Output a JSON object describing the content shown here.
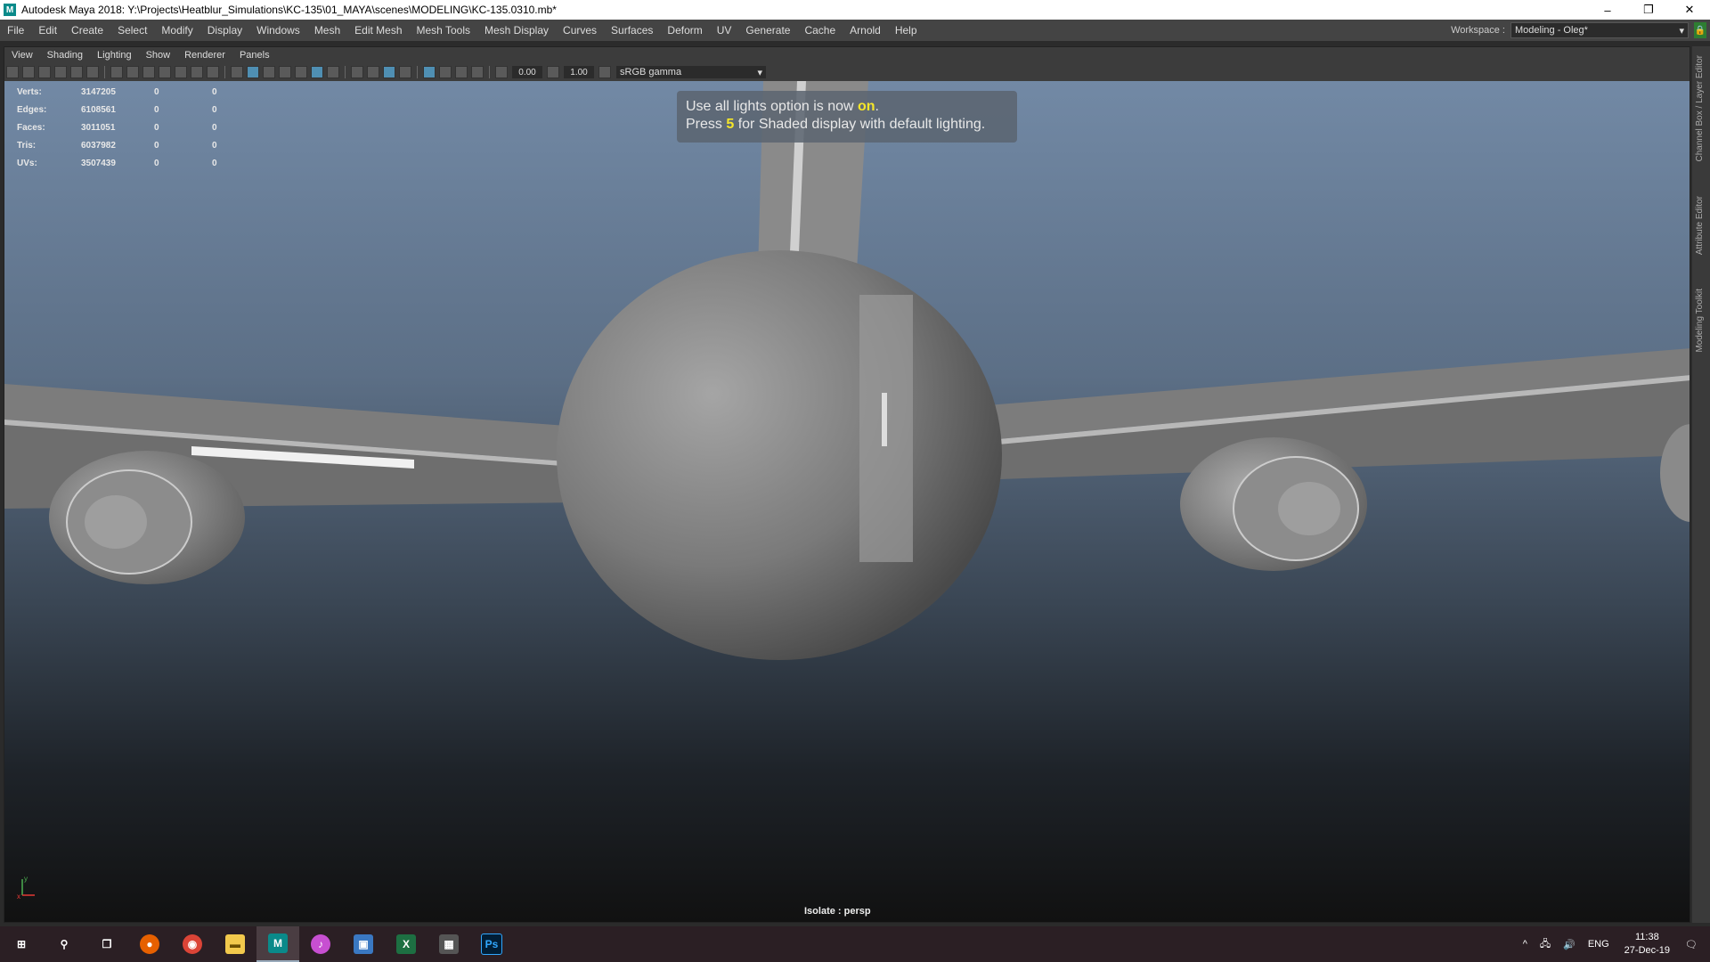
{
  "window": {
    "title": "Autodesk Maya 2018: Y:\\Projects\\Heatblur_Simulations\\KC-135\\01_MAYA\\scenes\\MODELING\\KC-135.0310.mb*",
    "app_icon_letter": "M",
    "minimize": "–",
    "restore": "❐",
    "close": "✕"
  },
  "menubar": {
    "items": [
      "File",
      "Edit",
      "Create",
      "Select",
      "Modify",
      "Display",
      "Windows",
      "Mesh",
      "Edit Mesh",
      "Mesh Tools",
      "Mesh Display",
      "Curves",
      "Surfaces",
      "Deform",
      "UV",
      "Generate",
      "Cache",
      "Arnold",
      "Help"
    ],
    "workspace_label": "Workspace :",
    "workspace_value": "Modeling - Oleg*"
  },
  "panel_menu": {
    "items": [
      "View",
      "Shading",
      "Lighting",
      "Show",
      "Renderer",
      "Panels"
    ]
  },
  "panel_toolbar": {
    "exposure": "0.00",
    "gamma": "1.00",
    "color_space": "sRGB gamma"
  },
  "hud": {
    "rows": [
      {
        "label": "Verts:",
        "total": "3147205",
        "sel": "0",
        "comp": "0"
      },
      {
        "label": "Edges:",
        "total": "6108561",
        "sel": "0",
        "comp": "0"
      },
      {
        "label": "Faces:",
        "total": "3011051",
        "sel": "0",
        "comp": "0"
      },
      {
        "label": "Tris:",
        "total": "6037982",
        "sel": "0",
        "comp": "0"
      },
      {
        "label": "UVs:",
        "total": "3507439",
        "sel": "0",
        "comp": "0"
      }
    ]
  },
  "notice": {
    "line1_pre": "Use all lights option is now ",
    "line1_hl": "on",
    "line1_post": ".",
    "line2_pre": "Press ",
    "line2_hl": "5",
    "line2_post": " for Shaded display with default lighting."
  },
  "viewport": {
    "isolate_label": "Isolate : persp",
    "axis_y": "y",
    "axis_x": "x"
  },
  "right_tabs": [
    "Channel Box / Layer Editor",
    "Attribute Editor",
    "Modeling Toolkit"
  ],
  "taskbar": {
    "apps": [
      {
        "name": "start",
        "glyph": "⊞",
        "color": "#2b1f24"
      },
      {
        "name": "search",
        "glyph": "⚲",
        "color": "#2b1f24"
      },
      {
        "name": "task-view",
        "glyph": "❒",
        "color": "#2b1f24"
      },
      {
        "name": "firefox",
        "glyph": "●",
        "color": "#e66000"
      },
      {
        "name": "chrome",
        "glyph": "◉",
        "color": "#db4437"
      },
      {
        "name": "file-explorer",
        "glyph": "▬",
        "color": "#f2c94c"
      },
      {
        "name": "maya",
        "glyph": "M",
        "color": "#0a8a8a"
      },
      {
        "name": "itunes",
        "glyph": "♪",
        "color": "#c74fd1"
      },
      {
        "name": "photos",
        "glyph": "▣",
        "color": "#3a78c2"
      },
      {
        "name": "excel",
        "glyph": "X",
        "color": "#1d6f42"
      },
      {
        "name": "calculator",
        "glyph": "▦",
        "color": "#555555"
      },
      {
        "name": "photoshop",
        "glyph": "Ps",
        "color": "#001e36"
      }
    ],
    "active_app": "maya",
    "tray_chevron": "^",
    "tray_network": "🖧",
    "tray_volume": "🔊",
    "language": "ENG",
    "time": "11:38",
    "date": "27-Dec-19",
    "notifications": "🗨"
  }
}
